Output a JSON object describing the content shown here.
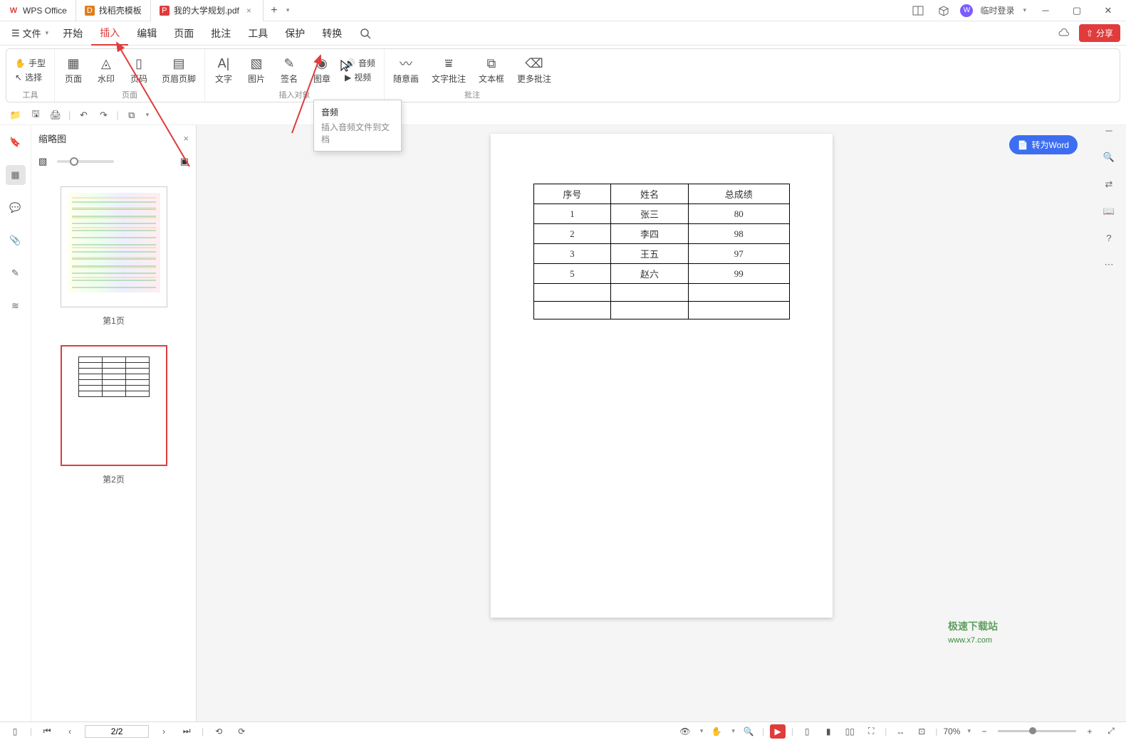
{
  "titlebar": {
    "tabs": [
      {
        "icon": "W",
        "iconColor": "#e03c3c",
        "label": "WPS Office"
      },
      {
        "icon": "D",
        "iconColor": "#e07c1c",
        "label": "找稻壳模板"
      },
      {
        "icon": "P",
        "iconColor": "#e03c3c",
        "label": "我的大学规划.pdf",
        "closable": true
      }
    ],
    "login": "临时登录"
  },
  "menubar": {
    "file": "文件",
    "items": [
      "开始",
      "插入",
      "编辑",
      "页面",
      "批注",
      "工具",
      "保护",
      "转换"
    ],
    "activeIndex": 1,
    "share": "分享"
  },
  "ribbon": {
    "group0": {
      "label": "工具",
      "hand": "手型",
      "select": "选择"
    },
    "group1": {
      "label": "页面",
      "items": [
        "页面",
        "水印",
        "页码",
        "页眉页脚"
      ]
    },
    "group2": {
      "label": "插入对象",
      "items": [
        "文字",
        "图片",
        "签名",
        "图章",
        "音频",
        "视频"
      ]
    },
    "group3": {
      "label": "批注",
      "items": [
        "随意画",
        "文字批注",
        "文本框",
        "更多批注"
      ]
    }
  },
  "thumbs": {
    "title": "缩略图",
    "page1": "第1页",
    "page2": "第2页"
  },
  "tooltip": {
    "title": "音频",
    "desc": "插入音频文件到文档"
  },
  "docTable": {
    "headers": [
      "序号",
      "姓名",
      "总成绩"
    ],
    "rows": [
      [
        "1",
        "张三",
        "80"
      ],
      [
        "2",
        "李四",
        "98"
      ],
      [
        "3",
        "王五",
        "97"
      ],
      [
        "5",
        "赵六",
        "99"
      ],
      [
        "",
        "",
        ""
      ],
      [
        "",
        "",
        ""
      ]
    ]
  },
  "convert": "转为Word",
  "status": {
    "page": "2/2",
    "zoom": "70%"
  },
  "watermark": {
    "l1": "极速下载站",
    "l2": "www.x7.com"
  }
}
